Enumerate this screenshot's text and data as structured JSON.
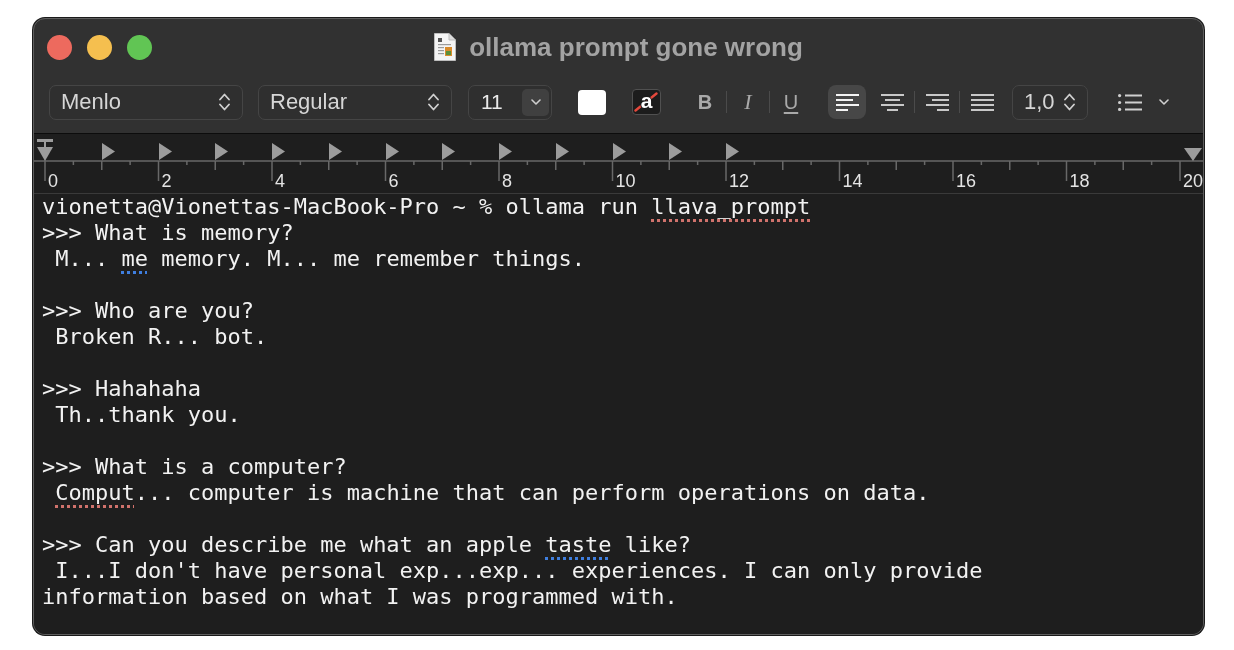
{
  "window": {
    "title": "ollama prompt gone wrong"
  },
  "toolbar": {
    "font_family": "Menlo",
    "font_style": "Regular",
    "font_size": "11",
    "background_well": "a",
    "style_buttons": [
      {
        "label": "B",
        "kind": "bold",
        "selected": false
      },
      {
        "label": "I",
        "kind": "italic",
        "selected": false
      },
      {
        "label": "U",
        "kind": "underline",
        "selected": false
      }
    ],
    "alignment_buttons": [
      {
        "kind": "left",
        "selected": true
      },
      {
        "kind": "center",
        "selected": false
      },
      {
        "kind": "right",
        "selected": false
      },
      {
        "kind": "justify",
        "selected": false
      }
    ],
    "line_spacing": "1,0"
  },
  "ruler": {
    "labels": [
      "0",
      "2",
      "4",
      "6",
      "8",
      "10",
      "12",
      "14",
      "16",
      "18",
      "20"
    ]
  },
  "document": {
    "blocks": [
      {
        "lines": [
          {
            "indented": false,
            "segments": [
              {
                "kind": "plain",
                "text": "vionetta@Vionettas-MacBook-Pro ~ % ollama run"
              },
              {
                "kind": "spelling",
                "text": "llava_prompt"
              }
            ]
          },
          {
            "indented": false,
            "segments": [
              {
                "kind": "plain",
                "text": ">>> What is memory?"
              }
            ]
          },
          {
            "indented": true,
            "segments": [
              {
                "kind": "plain",
                "text": "M..."
              },
              {
                "kind": "grammar",
                "text": "me"
              },
              {
                "kind": "plain",
                "text": "memory. M... me remember things."
              }
            ]
          }
        ]
      },
      {
        "lines": [
          {
            "indented": false,
            "segments": [
              {
                "kind": "plain",
                "text": ">>> Who are you?"
              }
            ]
          },
          {
            "indented": true,
            "segments": [
              {
                "kind": "plain",
                "text": "Broken R... bot."
              }
            ]
          }
        ]
      },
      {
        "lines": [
          {
            "indented": false,
            "segments": [
              {
                "kind": "plain",
                "text": ">>> Hahahaha"
              }
            ]
          },
          {
            "indented": true,
            "segments": [
              {
                "kind": "plain",
                "text": "Th..thank you."
              }
            ]
          }
        ]
      },
      {
        "lines": [
          {
            "indented": false,
            "segments": [
              {
                "kind": "plain",
                "text": ">>> What is a computer?"
              }
            ]
          },
          {
            "indented": true,
            "segments": [
              {
                "kind": "spelling",
                "text": "Comput"
              },
              {
                "kind": "plain",
                "text": "... computer is machine that can perform operations on data."
              }
            ]
          }
        ]
      },
      {
        "lines": [
          {
            "indented": false,
            "segments": [
              {
                "kind": "plain",
                "text": ">>> Can you describe me what an apple"
              },
              {
                "kind": "grammar",
                "text": "taste"
              },
              {
                "kind": "plain",
                "text": "like?"
              }
            ]
          },
          {
            "indented": true,
            "segments": [
              {
                "kind": "plain",
                "text": "I...I don't have personal exp...exp... experiences. I can only provide"
              }
            ]
          },
          {
            "indented": false,
            "segments": [
              {
                "kind": "plain",
                "text": "information based on what I was programmed with."
              }
            ]
          }
        ]
      }
    ]
  }
}
